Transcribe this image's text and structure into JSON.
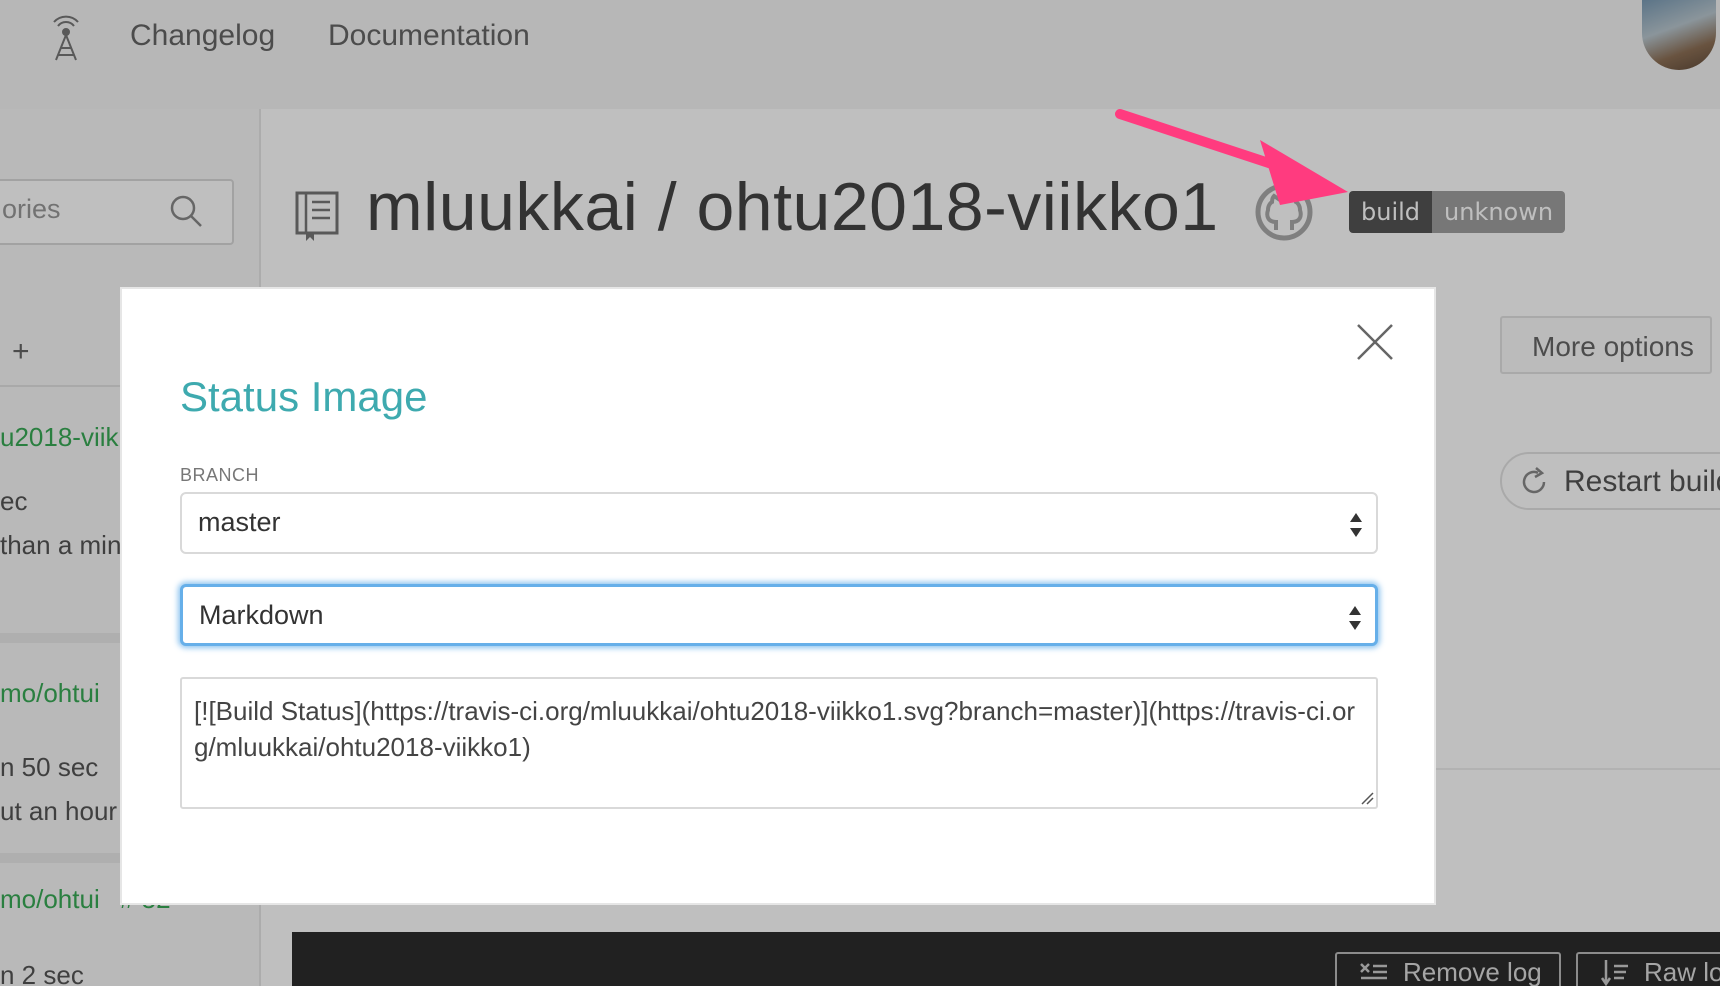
{
  "nav": {
    "changelog": "Changelog",
    "documentation": "Documentation"
  },
  "sidebar": {
    "search_placeholder": "ories",
    "add_label": "+",
    "repos": [
      {
        "name": "u2018-viik",
        "line1": "ec",
        "line2": "than a min"
      },
      {
        "name": "mo/ohtui",
        "line1": "n 50 sec",
        "line2": "ut an hour a"
      },
      {
        "name": "mo/ohtui",
        "build": "# 52",
        "line1": "n 2 sec"
      }
    ]
  },
  "repo": {
    "title": "mluukkai / ohtu2018-viikko1",
    "badge_left": "build",
    "badge_right": "unknown"
  },
  "actions": {
    "more_options": "More options",
    "restart_build": "Restart build",
    "remove_log": "Remove log",
    "raw_log": "Raw log"
  },
  "modal": {
    "title": "Status Image",
    "branch_label": "BRANCH",
    "branch_value": "master",
    "format_value": "Markdown",
    "code": "[![Build Status](https://travis-ci.org/mluukkai/ohtu2018-viikko1.svg?branch=master)](https://travis-ci.org/mluukkai/ohtu2018-viikko1)"
  },
  "colors": {
    "accent": "#3eaaaf",
    "success_green": "#39aa56",
    "annotation_arrow": "#ff3b7f",
    "focus_blue": "#66afe9"
  }
}
